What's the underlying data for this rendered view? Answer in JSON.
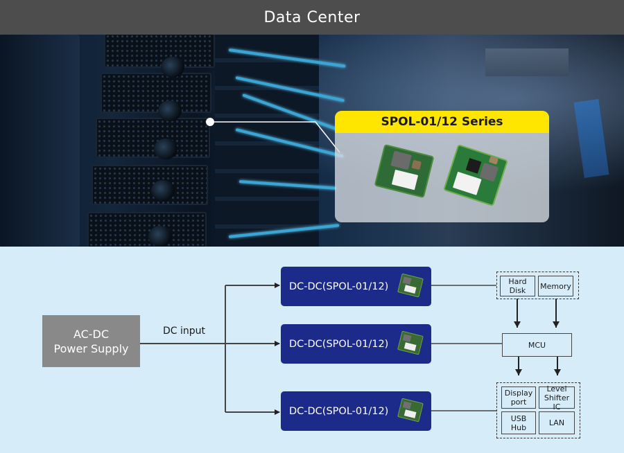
{
  "header": {
    "title": "Data Center"
  },
  "photo": {
    "subject": "server-rack",
    "callout": {
      "title": "SPOL-01/12 Series",
      "accent_color": "#ffe600",
      "products": [
        "spol-module-a",
        "spol-module-b"
      ]
    }
  },
  "diagram": {
    "source": {
      "label": "AC-DC\nPower Supply",
      "color": "#898989"
    },
    "connection_label": "DC input",
    "converters": [
      {
        "label": "DC-DC(SPOL-01/12)",
        "icon": "spol-module-icon"
      },
      {
        "label": "DC-DC(SPOL-01/12)",
        "icon": "spol-module-icon"
      },
      {
        "label": "DC-DC(SPOL-01/12)",
        "icon": "spol-module-icon"
      }
    ],
    "converter_color": "#1c2a8a",
    "loads": {
      "storage_group": [
        "Hard Disk",
        "Memory"
      ],
      "controller": "MCU",
      "peripheral_group": [
        "Display\nport",
        "Level\nShifter IC",
        "USB Hub",
        "LAN"
      ]
    }
  }
}
